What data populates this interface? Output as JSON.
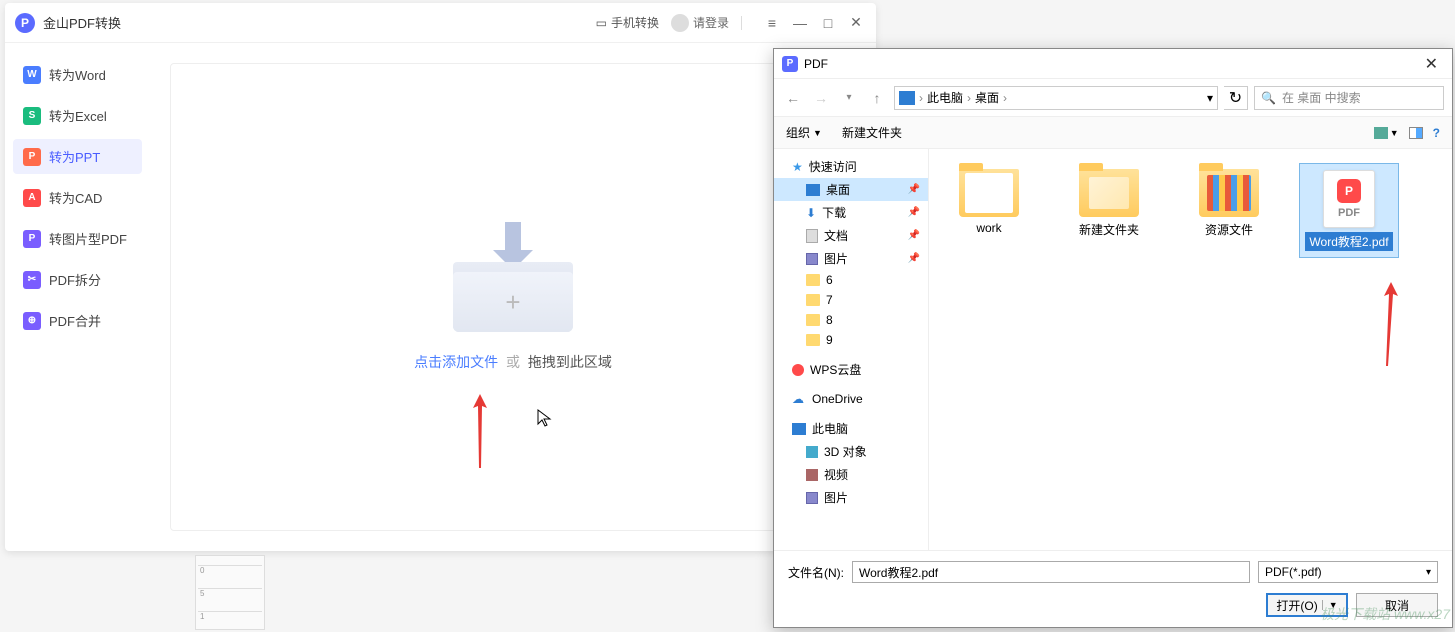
{
  "app": {
    "title": "金山PDF转换",
    "phone_convert": "手机转换",
    "login": "请登录"
  },
  "sidebar": {
    "items": [
      {
        "label": "转为Word",
        "icon": "W"
      },
      {
        "label": "转为Excel",
        "icon": "S"
      },
      {
        "label": "转为PPT",
        "icon": "P"
      },
      {
        "label": "转为CAD",
        "icon": "A"
      },
      {
        "label": "转图片型PDF",
        "icon": "P"
      },
      {
        "label": "PDF拆分",
        "icon": "✂"
      },
      {
        "label": "PDF合并",
        "icon": "⊕"
      }
    ]
  },
  "dropzone": {
    "click_text": "点击添加文件",
    "or": "或",
    "drag_text": "拖拽到此区域"
  },
  "dialog": {
    "title": "PDF",
    "path": {
      "pc": "此电脑",
      "desktop": "桌面"
    },
    "search_placeholder": "在 桌面 中搜索",
    "toolbar": {
      "organize": "组织",
      "new_folder": "新建文件夹"
    },
    "tree": {
      "quick": "快速访问",
      "desktop": "桌面",
      "downloads": "下载",
      "documents": "文档",
      "pictures": "图片",
      "f6": "6",
      "f7": "7",
      "f8": "8",
      "f9": "9",
      "wps": "WPS云盘",
      "onedrive": "OneDrive",
      "thispc": "此电脑",
      "obj3d": "3D 对象",
      "videos": "视频",
      "pictures2": "图片"
    },
    "files": [
      {
        "name": "work",
        "type": "folder-open"
      },
      {
        "name": "新建文件夹",
        "type": "folder-new"
      },
      {
        "name": "资源文件",
        "type": "folder-res"
      },
      {
        "name": "Word教程2.pdf",
        "type": "pdf"
      }
    ],
    "filename_label": "文件名(N):",
    "filename_value": "Word教程2.pdf",
    "filter": "PDF(*.pdf)",
    "open_btn": "打开(O)",
    "cancel_btn": "取消"
  },
  "ruler": [
    "0",
    "5",
    "1"
  ],
  "watermark": "极光下载站 www.x27"
}
